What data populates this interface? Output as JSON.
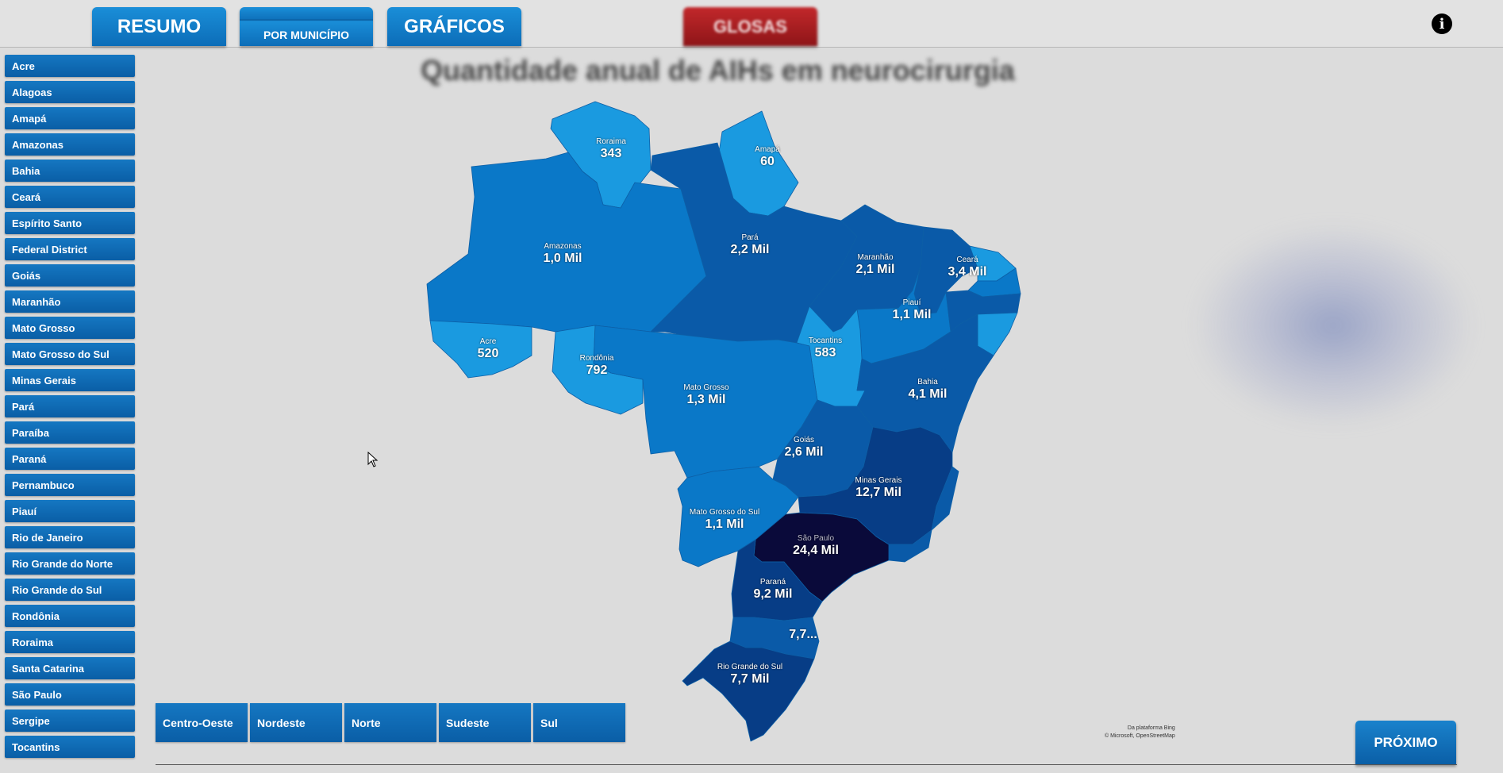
{
  "tabs": {
    "resumo": "RESUMO",
    "por_municipio": "POR MUNICÍPIO",
    "graficos": "GRÁFICOS",
    "glosas": "GLOSAS"
  },
  "info_icon": "i",
  "page_title": "Quantidade anual de AIHs em neurocirurgia",
  "sidebar": {
    "items": [
      "Acre",
      "Alagoas",
      "Amapá",
      "Amazonas",
      "Bahia",
      "Ceará",
      "Espírito Santo",
      "Federal District",
      "Goiás",
      "Maranhão",
      "Mato Grosso",
      "Mato Grosso do Sul",
      "Minas Gerais",
      "Pará",
      "Paraíba",
      "Paraná",
      "Pernambuco",
      "Piauí",
      "Rio de Janeiro",
      "Rio Grande do Norte",
      "Rio Grande do Sul",
      "Rondônia",
      "Roraima",
      "Santa Catarina",
      "São Paulo",
      "Sergipe",
      "Tocantins"
    ]
  },
  "map": {
    "regions": [
      {
        "name": "Roraima",
        "value": "343"
      },
      {
        "name": "Amapá",
        "value": "60"
      },
      {
        "name": "Amazonas",
        "value": "1,0 Mil"
      },
      {
        "name": "Pará",
        "value": "2,2 Mil"
      },
      {
        "name": "Maranhão",
        "value": "2,1 Mil"
      },
      {
        "name": "Ceará",
        "value": "3,4 Mil"
      },
      {
        "name": "Piauí",
        "value": "1,1 Mil"
      },
      {
        "name": "Acre",
        "value": "520"
      },
      {
        "name": "Rondônia",
        "value": "792"
      },
      {
        "name": "Tocantins",
        "value": "583"
      },
      {
        "name": "Mato Grosso",
        "value": "1,3 Mil"
      },
      {
        "name": "Bahia",
        "value": "4,1 Mil"
      },
      {
        "name": "Goiás",
        "value": "2,6 Mil"
      },
      {
        "name": "Minas Gerais",
        "value": "12,7 Mil"
      },
      {
        "name": "Mato Grosso do Sul",
        "value": "1,1 Mil"
      },
      {
        "name": "São Paulo",
        "value": "24,4 Mil"
      },
      {
        "name": "Paraná",
        "value": "9,2 Mil"
      },
      {
        "name": "",
        "value": "7,7..."
      },
      {
        "name": "Rio Grande do Sul",
        "value": "7,7 Mil"
      }
    ],
    "colors": {
      "light": "#1a9ae0",
      "mid": "#0a78c8",
      "dark": "#0a5aa8",
      "darker": "#073d86",
      "darkest": "#0a0a3a"
    },
    "attribution_line1": "Da plataforma Bing",
    "attribution_line2": "© Microsoft, OpenStreetMap"
  },
  "regions_bar": [
    "Centro-Oeste",
    "Nordeste",
    "Norte",
    "Sudeste",
    "Sul"
  ],
  "next_button": "PRÓXIMO"
}
